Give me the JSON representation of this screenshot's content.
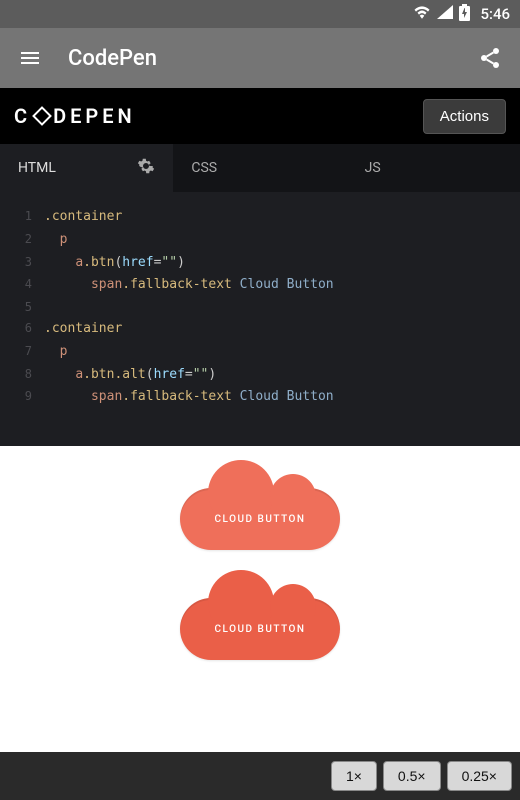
{
  "status": {
    "time": "5:46"
  },
  "appbar": {
    "title": "CodePen"
  },
  "logo_text": "C   DEPEN",
  "actions_label": "Actions",
  "tabs": [
    {
      "label": "HTML",
      "active": true
    },
    {
      "label": "CSS",
      "active": false
    },
    {
      "label": "JS",
      "active": false
    }
  ],
  "code": {
    "lines": [
      {
        "n": 1,
        "indent": 0,
        "segs": [
          [
            ".container",
            "tok-sel"
          ]
        ]
      },
      {
        "n": 2,
        "indent": 1,
        "segs": [
          [
            "p",
            "tok-tag"
          ]
        ]
      },
      {
        "n": 3,
        "indent": 2,
        "segs": [
          [
            "a",
            "tok-tag"
          ],
          [
            ".btn",
            "tok-class"
          ],
          [
            "(",
            "tok-punct"
          ],
          [
            "href",
            "tok-attr"
          ],
          [
            "=",
            "tok-punct"
          ],
          [
            "\"\"",
            "tok-str"
          ],
          [
            ")",
            "tok-punct"
          ]
        ]
      },
      {
        "n": 4,
        "indent": 3,
        "segs": [
          [
            "span",
            "tok-tag"
          ],
          [
            ".fallback-text",
            "tok-class"
          ],
          [
            " Cloud Button",
            "tok-text"
          ]
        ]
      },
      {
        "n": 5,
        "indent": 0,
        "segs": []
      },
      {
        "n": 6,
        "indent": 0,
        "segs": [
          [
            ".container",
            "tok-sel"
          ]
        ]
      },
      {
        "n": 7,
        "indent": 1,
        "segs": [
          [
            "p",
            "tok-tag"
          ]
        ]
      },
      {
        "n": 8,
        "indent": 2,
        "segs": [
          [
            "a",
            "tok-tag"
          ],
          [
            ".btn",
            "tok-class"
          ],
          [
            ".alt",
            "tok-class"
          ],
          [
            "(",
            "tok-punct"
          ],
          [
            "href",
            "tok-attr"
          ],
          [
            "=",
            "tok-punct"
          ],
          [
            "\"\"",
            "tok-str"
          ],
          [
            ")",
            "tok-punct"
          ]
        ]
      },
      {
        "n": 9,
        "indent": 3,
        "segs": [
          [
            "span",
            "tok-tag"
          ],
          [
            ".fallback-text",
            "tok-class"
          ],
          [
            " Cloud Button",
            "tok-text"
          ]
        ]
      }
    ]
  },
  "preview": {
    "button1": "CLOUD BUTTON",
    "button2": "CLOUD BUTTON"
  },
  "zoom": [
    {
      "label": "1×"
    },
    {
      "label": "0.5×"
    },
    {
      "label": "0.25×"
    }
  ]
}
